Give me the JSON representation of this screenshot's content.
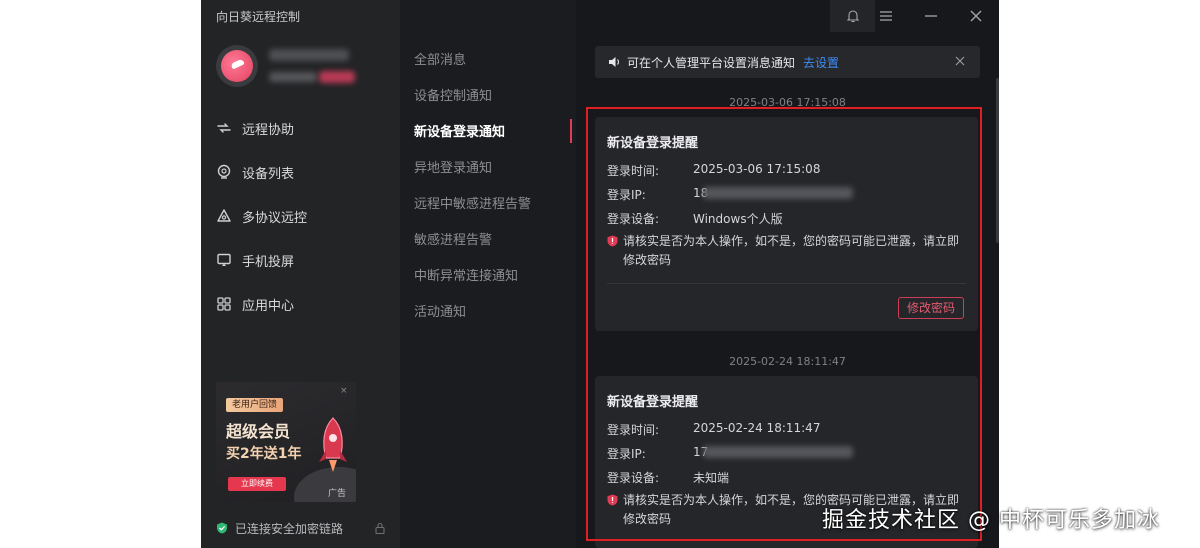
{
  "app": {
    "title": "向日葵远程控制"
  },
  "sidebar": {
    "items": [
      {
        "label": "远程协助",
        "icon": "remote-assist-icon"
      },
      {
        "label": "设备列表",
        "icon": "device-list-icon"
      },
      {
        "label": "多协议远控",
        "icon": "multi-protocol-icon"
      },
      {
        "label": "手机投屏",
        "icon": "screen-cast-icon"
      },
      {
        "label": "应用中心",
        "icon": "app-center-icon"
      }
    ],
    "ad": {
      "tag": "老用户回馈",
      "line1": "超级会员",
      "line2": "买2年送1年",
      "button": "立即续费",
      "label": "广告",
      "close": "×"
    },
    "status": "已连接安全加密链路"
  },
  "categories": [
    {
      "label": "全部消息",
      "active": false
    },
    {
      "label": "设备控制通知",
      "active": false
    },
    {
      "label": "新设备登录通知",
      "active": true
    },
    {
      "label": "异地登录通知",
      "active": false
    },
    {
      "label": "远程中敏感进程告警",
      "active": false
    },
    {
      "label": "敏感进程告警",
      "active": false
    },
    {
      "label": "中断异常连接通知",
      "active": false
    },
    {
      "label": "活动通知",
      "active": false
    }
  ],
  "notice": {
    "text": "可在个人管理平台设置消息通知",
    "link": "去设置"
  },
  "messages": [
    {
      "timestamp": "2025-03-06 17:15:08",
      "title": "新设备登录提醒",
      "time_label": "登录时间:",
      "time_value": "2025-03-06 17:15:08",
      "ip_label": "登录IP:",
      "ip_value": "18",
      "device_label": "登录设备:",
      "device_value": "Windows个人版",
      "warning": "请核实是否为本人操作，如不是，您的密码可能已泄露，请立即修改密码",
      "button": "修改密码"
    },
    {
      "timestamp": "2025-02-24 18:11:47",
      "title": "新设备登录提醒",
      "time_label": "登录时间:",
      "time_value": "2025-02-24 18:11:47",
      "ip_label": "登录IP:",
      "ip_value": "17",
      "device_label": "登录设备:",
      "device_value": "未知端",
      "warning": "请核实是否为本人操作，如不是，您的密码可能已泄露，请立即修改密码"
    }
  ],
  "watermark": "掘金技术社区 @ 中杯可乐多加冰",
  "colors": {
    "accent": "#e23b55",
    "link": "#3e8ef7",
    "highlight_box": "#e01f25",
    "window_bg": "#17181b"
  }
}
